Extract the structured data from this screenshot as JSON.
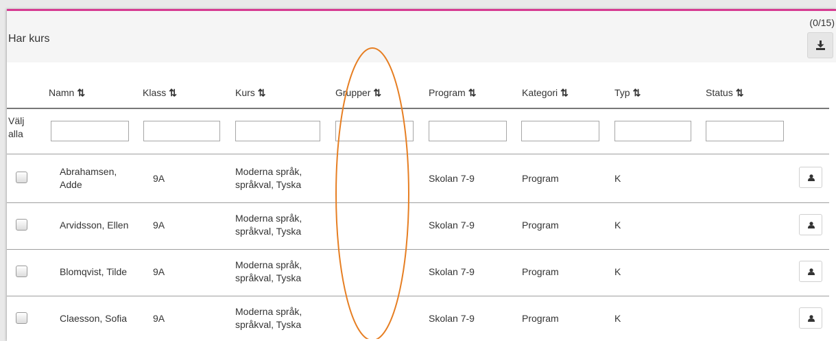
{
  "panel": {
    "title": "Har kurs",
    "count": "(0/15)",
    "accent_color": "#d63a91",
    "export_icon": "download-icon"
  },
  "columns": [
    {
      "label": "Namn",
      "sort_icon": "⇅"
    },
    {
      "label": "Klass",
      "sort_icon": "⇅"
    },
    {
      "label": "Kurs",
      "sort_icon": "⇅"
    },
    {
      "label": "Grupper",
      "sort_icon": "⇅"
    },
    {
      "label": "Program",
      "sort_icon": "⇅"
    },
    {
      "label": "Kategori",
      "sort_icon": "⇅"
    },
    {
      "label": "Typ",
      "sort_icon": "⇅"
    },
    {
      "label": "Status",
      "sort_icon": "⇅"
    }
  ],
  "select_all": {
    "line1": "Välj",
    "line2": "alla"
  },
  "filters": [
    "",
    "",
    "",
    "",
    "",
    "",
    "",
    ""
  ],
  "rows": [
    {
      "name1": "Abrahamsen,",
      "name2": "Adde",
      "klass": "9A",
      "kurs1": "Moderna språk,",
      "kurs2": "språkval, Tyska",
      "grupper": "",
      "program": "Skolan 7-9",
      "kategori": "Program",
      "typ": "K",
      "status": "",
      "checked": false,
      "action_icon": "user-icon"
    },
    {
      "name1": "Arvidsson, Ellen",
      "name2": "",
      "klass": "9A",
      "kurs1": "Moderna språk,",
      "kurs2": "språkval, Tyska",
      "grupper": "",
      "program": "Skolan 7-9",
      "kategori": "Program",
      "typ": "K",
      "status": "",
      "checked": false,
      "action_icon": "user-icon"
    },
    {
      "name1": "Blomqvist, Tilde",
      "name2": "",
      "klass": "9A",
      "kurs1": "Moderna språk,",
      "kurs2": "språkval, Tyska",
      "grupper": "",
      "program": "Skolan 7-9",
      "kategori": "Program",
      "typ": "K",
      "status": "",
      "checked": false,
      "action_icon": "user-icon"
    },
    {
      "name1": "Claesson, Sofia",
      "name2": "",
      "klass": "9A",
      "kurs1": "Moderna språk,",
      "kurs2": "språkval, Tyska",
      "grupper": "",
      "program": "Skolan 7-9",
      "kategori": "Program",
      "typ": "K",
      "status": "",
      "checked": false,
      "action_icon": "user-icon"
    }
  ],
  "annotation": {
    "color": "#e67e22"
  }
}
